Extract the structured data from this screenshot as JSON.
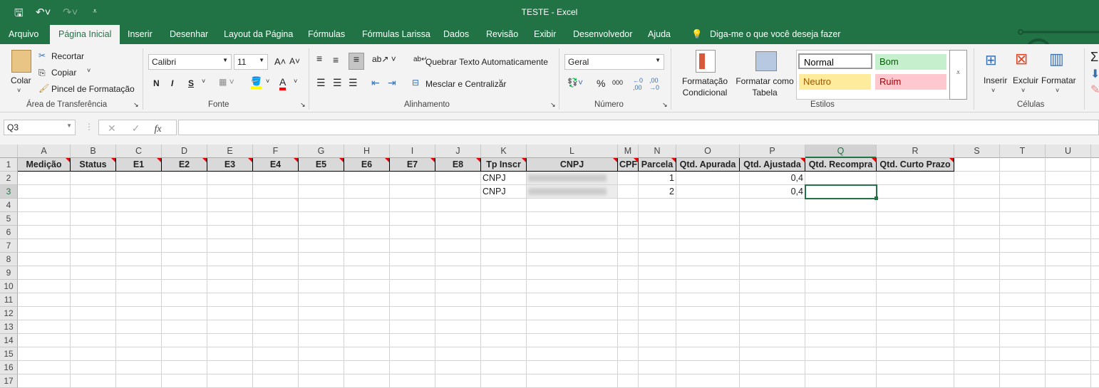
{
  "window": {
    "title": "TESTE  -  Excel"
  },
  "quick_access": {
    "save_icon": "save-icon",
    "undo_icon": "undo-icon",
    "redo_icon": "redo-icon",
    "customize_icon": "customize-icon"
  },
  "tabs": [
    "Arquivo",
    "Página Inicial",
    "Inserir",
    "Desenhar",
    "Layout da Página",
    "Fórmulas",
    "Fórmulas Larissa",
    "Dados",
    "Revisão",
    "Exibir",
    "Desenvolvedor",
    "Ajuda"
  ],
  "active_tab": "Página Inicial",
  "tell_me": "Diga-me o que você deseja fazer",
  "ribbon": {
    "clipboard": {
      "paste": "Colar",
      "cut": "Recortar",
      "copy": "Copiar",
      "format_painter": "Pincel de Formatação",
      "label": "Área de Transferência"
    },
    "font": {
      "name": "Calibri",
      "size": "11",
      "bold": "N",
      "italic": "I",
      "underline": "S",
      "label": "Fonte",
      "fill_color": "#ffff00",
      "font_color": "#ff0000"
    },
    "alignment": {
      "wrap": "Quebrar Texto Automaticamente",
      "merge": "Mesclar e Centralizar",
      "label": "Alinhamento"
    },
    "number": {
      "format": "Geral",
      "percent": "%",
      "thousands": "000",
      "label": "Número"
    },
    "styles": {
      "conditional": "Formatação Condicional",
      "as_table": "Formatar como Tabela",
      "normal": "Normal",
      "good": "Bom",
      "neutral": "Neutro",
      "bad": "Ruim",
      "label": "Estilos"
    },
    "cells": {
      "insert": "Inserir",
      "delete": "Excluir",
      "format": "Formatar",
      "label": "Células"
    }
  },
  "formula_bar": {
    "name_box": "Q3",
    "fx": "fx",
    "value": ""
  },
  "sheet": {
    "columns": [
      "A",
      "B",
      "C",
      "D",
      "E",
      "F",
      "G",
      "H",
      "I",
      "J",
      "K",
      "L",
      "M",
      "N",
      "O",
      "P",
      "Q",
      "R",
      "S",
      "T",
      "U"
    ],
    "row_numbers": [
      "1",
      "2",
      "3",
      "4",
      "5",
      "6",
      "7",
      "8",
      "9",
      "10",
      "11",
      "12",
      "13",
      "14",
      "15",
      "16",
      "17"
    ],
    "headers": [
      "Medição",
      "Status",
      "E1",
      "E2",
      "E3",
      "E4",
      "E5",
      "E6",
      "E7",
      "E8",
      "Tp Inscr",
      "CNPJ",
      "CPF",
      "Parcela",
      "Qtd. Apurada",
      "Qtd. Ajustada",
      "Qtd. Recompra",
      "Qtd. Curto Prazo"
    ],
    "comment_flags": [
      true,
      true,
      true,
      true,
      true,
      true,
      true,
      true,
      true,
      true,
      true,
      true,
      true,
      true,
      false,
      true,
      true,
      true
    ],
    "rows": [
      {
        "K": "CNPJ",
        "N": "1",
        "P": "0,4"
      },
      {
        "K": "CNPJ",
        "N": "2",
        "P": "0,4"
      }
    ],
    "selected_cell": "Q3"
  }
}
